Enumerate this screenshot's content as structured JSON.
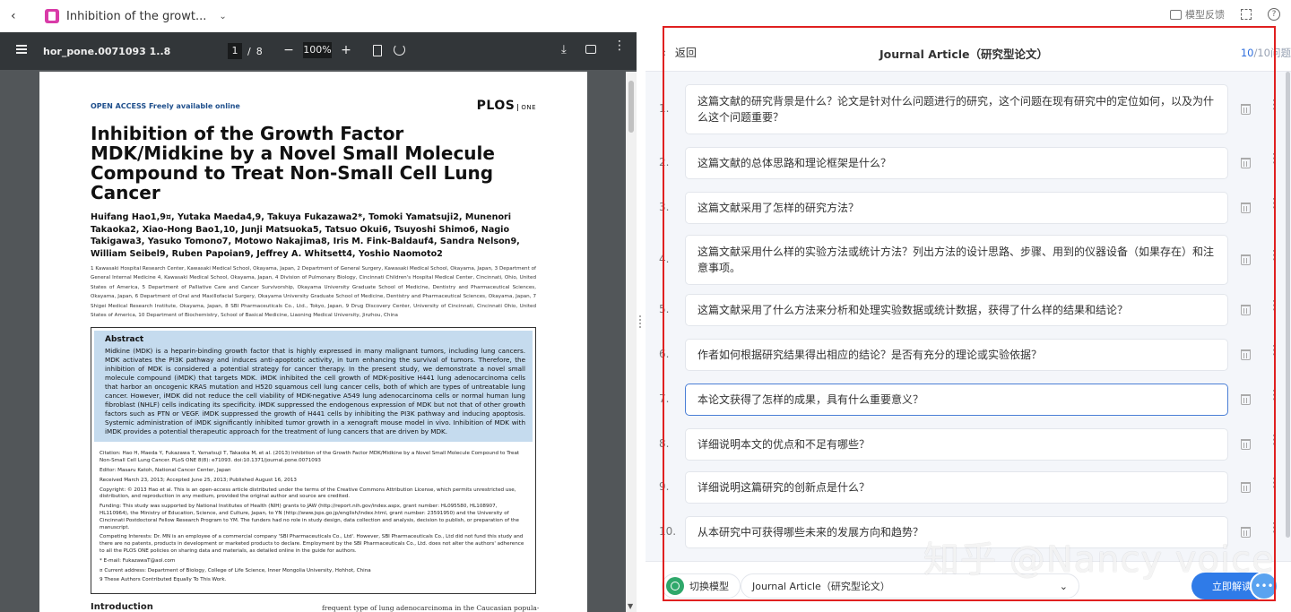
{
  "browser_tab": {
    "title": "Inhibition of the growt...",
    "feedback_label": "模型反馈"
  },
  "pdf_toolbar": {
    "filename": "hor_pone.0071093 1..8",
    "current_page": "1",
    "total_pages": "8",
    "zoom": "100%"
  },
  "pdf_page": {
    "open_access": "OPEN ACCESS Freely available online",
    "journal_logo": "PLOS",
    "journal_logo_suffix": "ONE",
    "title": "Inhibition of the Growth Factor MDK/Midkine by a Novel Small Molecule Compound to Treat Non-Small Cell Lung Cancer",
    "authors": "Huifang Hao1,9¤, Yutaka Maeda4,9, Takuya Fukazawa2*, Tomoki Yamatsuji2, Munenori Takaoka2, Xiao-Hong Bao1,10, Junji Matsuoka5, Tatsuo Okui6, Tsuyoshi Shimo6, Nagio Takigawa3, Yasuko Tomono7, Motowo Nakajima8, Iris M. Fink-Baldauf4, Sandra Nelson9, William Seibel9, Ruben Papoian9, Jeffrey A. Whitsett4, Yoshio Naomoto2",
    "affiliations": "1 Kawasaki Hospital Research Center, Kawasaki Medical School, Okayama, Japan, 2 Department of General Surgery, Kawasaki Medical School, Okayama, Japan, 3 Department of General Internal Medicine 4, Kawasaki Medical School, Okayama, Japan, 4 Division of Pulmonary Biology, Cincinnati Children's Hospital Medical Center, Cincinnati, Ohio, United States of America, 5 Department of Palliative Care and Cancer Survivorship, Okayama University Graduate School of Medicine, Dentistry and Pharmaceutical Sciences, Okayama, Japan, 6 Department of Oral and Maxillofacial Surgery, Okayama University Graduate School of Medicine, Dentistry and Pharmaceutical Sciences, Okayama, Japan, 7 Shigei Medical Research Institute, Okayama, Japan, 8 SBI Pharmaceuticals Co., Ltd., Tokyo, Japan, 9 Drug Discovery Center, University of Cincinnati, Cincinnati Ohio, United States of America, 10 Department of Biochemistry, School of Basical Medicine, Liaoning Medical University, Jinzhou, China",
    "abstract_heading": "Abstract",
    "abstract_text": "Midkine (MDK) is a heparin-binding growth factor that is highly expressed in many malignant tumors, including lung cancers. MDK activates the PI3K pathway and induces anti-apoptotic activity, in turn enhancing the survival of tumors. Therefore, the inhibition of MDK is considered a potential strategy for cancer therapy. In the present study, we demonstrate a novel small molecule compound (iMDK) that targets MDK. iMDK inhibited the cell growth of MDK-positive H441 lung adenocarcinoma cells that harbor an oncogenic KRAS mutation and H520 squamous cell lung cancer cells, both of which are types of untreatable lung cancer. However, iMDK did not reduce the cell viability of MDK-negative A549 lung adenocarcinoma cells or normal human lung fibroblast (NHLF) cells indicating its specificity. iMDK suppressed the endogenous expression of MDK but not that of other growth factors such as PTN or VEGF. iMDK suppressed the growth of H441 cells by inhibiting the PI3K pathway and inducing apoptosis. Systemic administration of iMDK significantly inhibited tumor growth in a xenograft mouse model in vivo. Inhibition of MDK with iMDK provides a potential therapeutic approach for the treatment of lung cancers that are driven by MDK.",
    "citation": "Citation: Hao H, Maeda Y, Fukazawa T, Yamatsuji T, Takaoka M, et al. (2013) Inhibition of the Growth Factor MDK/Midkine by a Novel Small Molecule Compound to Treat Non-Small Cell Lung Cancer. PLoS ONE 8(8): e71093. doi:10.1371/journal.pone.0071093",
    "editor": "Editor: Masaru Katoh, National Cancer Center, Japan",
    "dates": "Received March 23, 2013; Accepted June 25, 2013; Published August 16, 2013",
    "copyright": "Copyright: © 2013 Hao et al. This is an open-access article distributed under the terms of the Creative Commons Attribution License, which permits unrestricted use, distribution, and reproduction in any medium, provided the original author and source are credited.",
    "funding": "Funding: This study was supported by National Institutes of Health (NIH) grants to JAW (http://report.nih.gov/index.aspx, grant number: HL095580, HL108907, HL110964), the Ministry of Education, Science, and Culture, Japan, to YN (http://www.jsps.go.jp/english/index.html, grant number: 23591950) and the University of Cincinnati Postdoctoral Fellow Research Program to YM. The funders had no role in study design, data collection and analysis, decision to publish, or preparation of the manuscript.",
    "competing": "Competing Interests: Dr. MN is an employee of a commercial company 'SBI Pharmaceuticals Co., Ltd'. However, SBI Pharmaceuticals Co., Ltd did not fund this study and there are no patents, products in development or marketed products to declare. Employment by the SBI Pharmaceuticals Co., Ltd. does not alter the authors' adherence to all the PLOS ONE policies on sharing data and materials, as detailed online in the guide for authors.",
    "email": "* E-mail: FukazawaT@aol.com",
    "current_address": "¤ Current address: Department of Biology, College of Life Science, Inner Mongolia University, Hohhot, China",
    "equal": "9 These Authors Contributed Equally To This Work.",
    "intro_heading": "Introduction",
    "intro_fragment": "frequent type of lung adenocarcinoma in the Caucasian popula-"
  },
  "panel": {
    "back_label": "返回",
    "title": "Journal Article（研究型论文）",
    "count_current": "10",
    "count_rest": "/10问题",
    "questions": [
      {
        "num": "1.",
        "text": "这篇文献的研究背景是什么？论文是针对什么问题进行的研究，这个问题在现有研究中的定位如何，以及为什么这个问题重要？"
      },
      {
        "num": "2.",
        "text": "这篇文献的总体思路和理论框架是什么？"
      },
      {
        "num": "3.",
        "text": "这篇文献采用了怎样的研究方法？"
      },
      {
        "num": "4.",
        "text": "这篇文献采用什么样的实验方法或统计方法？列出方法的设计思路、步骤、用到的仪器设备（如果存在）和注意事项。"
      },
      {
        "num": "5.",
        "text": "这篇文献采用了什么方法来分析和处理实验数据或统计数据，获得了什么样的结果和结论？"
      },
      {
        "num": "6.",
        "text": "作者如何根据研究结果得出相应的结论？是否有充分的理论或实验依据？"
      },
      {
        "num": "7.",
        "text": "本论文获得了怎样的成果，具有什么重要意义？"
      },
      {
        "num": "8.",
        "text": "详细说明本文的优点和不足有哪些？"
      },
      {
        "num": "9.",
        "text": "详细说明这篇研究的创新点是什么？"
      },
      {
        "num": "10.",
        "text": "从本研究中可获得哪些未来的发展方向和趋势？"
      }
    ],
    "switch_model_label": "切换模型",
    "model_select_value": "Journal Article（研究型论文）",
    "start_button": "立即解读"
  },
  "watermark": "知乎 @Nancy voice"
}
